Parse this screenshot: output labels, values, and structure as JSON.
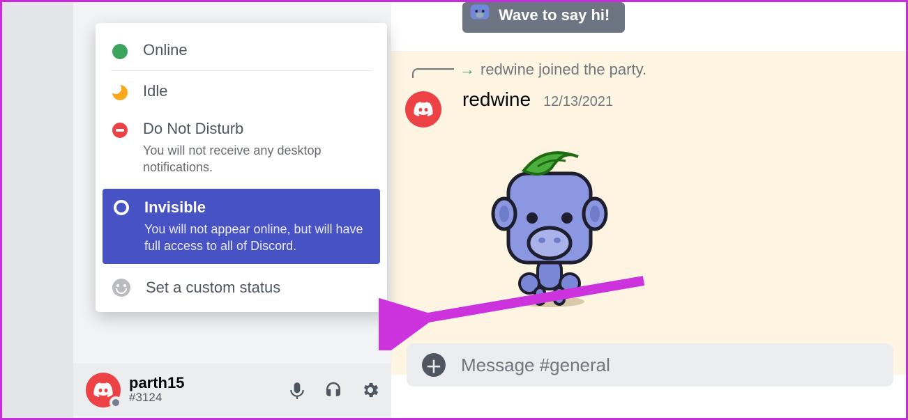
{
  "wave_chip": {
    "label": "Wave to say hi!"
  },
  "system_message": {
    "text": "redwine joined the party."
  },
  "message": {
    "author": "redwine",
    "timestamp": "12/13/2021"
  },
  "message_input": {
    "placeholder": "Message #general"
  },
  "user_panel": {
    "name": "parth15",
    "discriminator": "#3124"
  },
  "status_popover": {
    "online": {
      "label": "Online"
    },
    "idle": {
      "label": "Idle"
    },
    "dnd": {
      "label": "Do Not Disturb",
      "sub": "You will not receive any desktop notifications."
    },
    "invisible": {
      "label": "Invisible",
      "sub": "You will not appear online, but will have full access to all of Discord."
    },
    "custom": {
      "label": "Set a custom status"
    }
  }
}
